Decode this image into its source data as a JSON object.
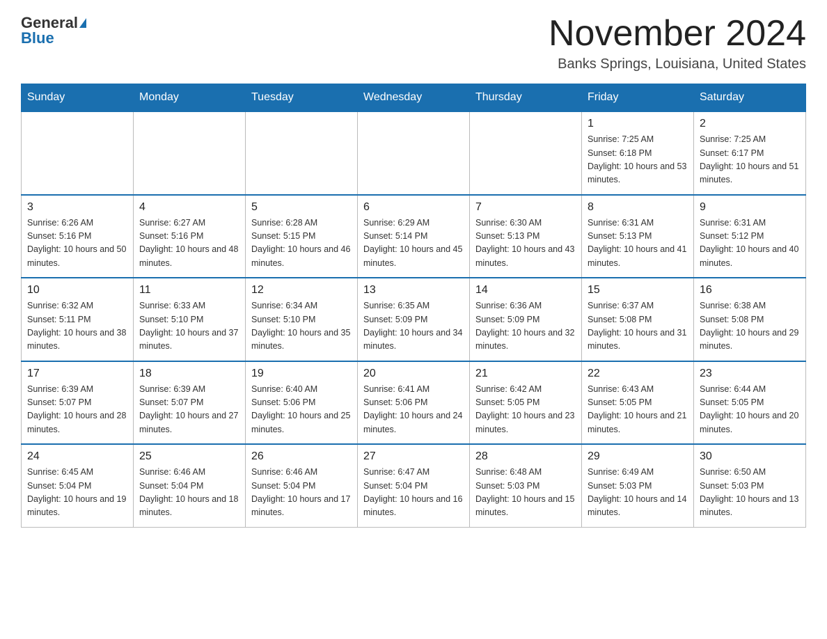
{
  "header": {
    "logo_general": "General",
    "logo_blue": "Blue",
    "month_title": "November 2024",
    "location": "Banks Springs, Louisiana, United States"
  },
  "calendar": {
    "days_of_week": [
      "Sunday",
      "Monday",
      "Tuesday",
      "Wednesday",
      "Thursday",
      "Friday",
      "Saturday"
    ],
    "weeks": [
      [
        {
          "day": "",
          "info": ""
        },
        {
          "day": "",
          "info": ""
        },
        {
          "day": "",
          "info": ""
        },
        {
          "day": "",
          "info": ""
        },
        {
          "day": "",
          "info": ""
        },
        {
          "day": "1",
          "info": "Sunrise: 7:25 AM\nSunset: 6:18 PM\nDaylight: 10 hours and 53 minutes."
        },
        {
          "day": "2",
          "info": "Sunrise: 7:25 AM\nSunset: 6:17 PM\nDaylight: 10 hours and 51 minutes."
        }
      ],
      [
        {
          "day": "3",
          "info": "Sunrise: 6:26 AM\nSunset: 5:16 PM\nDaylight: 10 hours and 50 minutes."
        },
        {
          "day": "4",
          "info": "Sunrise: 6:27 AM\nSunset: 5:16 PM\nDaylight: 10 hours and 48 minutes."
        },
        {
          "day": "5",
          "info": "Sunrise: 6:28 AM\nSunset: 5:15 PM\nDaylight: 10 hours and 46 minutes."
        },
        {
          "day": "6",
          "info": "Sunrise: 6:29 AM\nSunset: 5:14 PM\nDaylight: 10 hours and 45 minutes."
        },
        {
          "day": "7",
          "info": "Sunrise: 6:30 AM\nSunset: 5:13 PM\nDaylight: 10 hours and 43 minutes."
        },
        {
          "day": "8",
          "info": "Sunrise: 6:31 AM\nSunset: 5:13 PM\nDaylight: 10 hours and 41 minutes."
        },
        {
          "day": "9",
          "info": "Sunrise: 6:31 AM\nSunset: 5:12 PM\nDaylight: 10 hours and 40 minutes."
        }
      ],
      [
        {
          "day": "10",
          "info": "Sunrise: 6:32 AM\nSunset: 5:11 PM\nDaylight: 10 hours and 38 minutes."
        },
        {
          "day": "11",
          "info": "Sunrise: 6:33 AM\nSunset: 5:10 PM\nDaylight: 10 hours and 37 minutes."
        },
        {
          "day": "12",
          "info": "Sunrise: 6:34 AM\nSunset: 5:10 PM\nDaylight: 10 hours and 35 minutes."
        },
        {
          "day": "13",
          "info": "Sunrise: 6:35 AM\nSunset: 5:09 PM\nDaylight: 10 hours and 34 minutes."
        },
        {
          "day": "14",
          "info": "Sunrise: 6:36 AM\nSunset: 5:09 PM\nDaylight: 10 hours and 32 minutes."
        },
        {
          "day": "15",
          "info": "Sunrise: 6:37 AM\nSunset: 5:08 PM\nDaylight: 10 hours and 31 minutes."
        },
        {
          "day": "16",
          "info": "Sunrise: 6:38 AM\nSunset: 5:08 PM\nDaylight: 10 hours and 29 minutes."
        }
      ],
      [
        {
          "day": "17",
          "info": "Sunrise: 6:39 AM\nSunset: 5:07 PM\nDaylight: 10 hours and 28 minutes."
        },
        {
          "day": "18",
          "info": "Sunrise: 6:39 AM\nSunset: 5:07 PM\nDaylight: 10 hours and 27 minutes."
        },
        {
          "day": "19",
          "info": "Sunrise: 6:40 AM\nSunset: 5:06 PM\nDaylight: 10 hours and 25 minutes."
        },
        {
          "day": "20",
          "info": "Sunrise: 6:41 AM\nSunset: 5:06 PM\nDaylight: 10 hours and 24 minutes."
        },
        {
          "day": "21",
          "info": "Sunrise: 6:42 AM\nSunset: 5:05 PM\nDaylight: 10 hours and 23 minutes."
        },
        {
          "day": "22",
          "info": "Sunrise: 6:43 AM\nSunset: 5:05 PM\nDaylight: 10 hours and 21 minutes."
        },
        {
          "day": "23",
          "info": "Sunrise: 6:44 AM\nSunset: 5:05 PM\nDaylight: 10 hours and 20 minutes."
        }
      ],
      [
        {
          "day": "24",
          "info": "Sunrise: 6:45 AM\nSunset: 5:04 PM\nDaylight: 10 hours and 19 minutes."
        },
        {
          "day": "25",
          "info": "Sunrise: 6:46 AM\nSunset: 5:04 PM\nDaylight: 10 hours and 18 minutes."
        },
        {
          "day": "26",
          "info": "Sunrise: 6:46 AM\nSunset: 5:04 PM\nDaylight: 10 hours and 17 minutes."
        },
        {
          "day": "27",
          "info": "Sunrise: 6:47 AM\nSunset: 5:04 PM\nDaylight: 10 hours and 16 minutes."
        },
        {
          "day": "28",
          "info": "Sunrise: 6:48 AM\nSunset: 5:03 PM\nDaylight: 10 hours and 15 minutes."
        },
        {
          "day": "29",
          "info": "Sunrise: 6:49 AM\nSunset: 5:03 PM\nDaylight: 10 hours and 14 minutes."
        },
        {
          "day": "30",
          "info": "Sunrise: 6:50 AM\nSunset: 5:03 PM\nDaylight: 10 hours and 13 minutes."
        }
      ]
    ]
  }
}
